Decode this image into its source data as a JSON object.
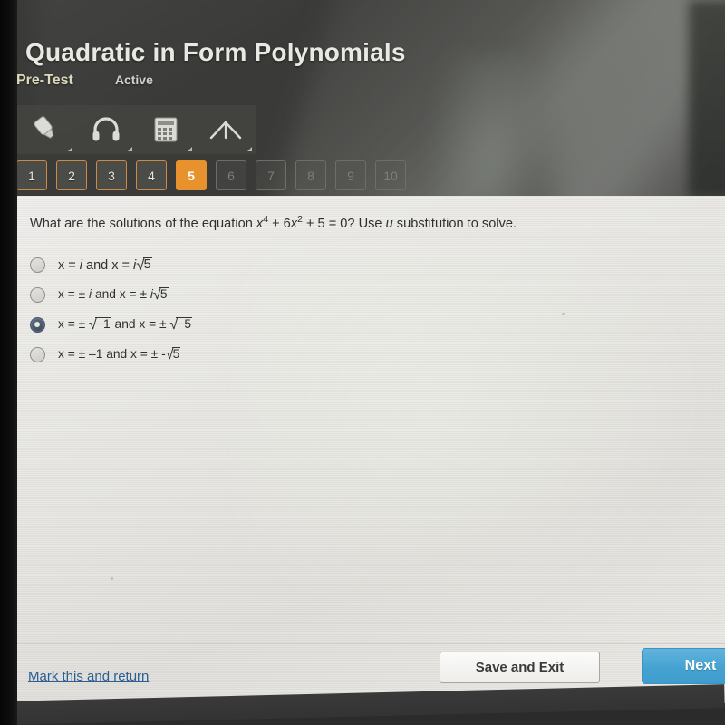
{
  "header": {
    "title": "Quadratic in Form Polynomials",
    "assignment_type": "Pre-Test",
    "status": "Active"
  },
  "toolbar": {
    "items": [
      {
        "name": "highlighter-icon",
        "label": "Highlighter"
      },
      {
        "name": "headphones-icon",
        "label": "Read Aloud"
      },
      {
        "name": "calculator-icon",
        "label": "Calculator"
      },
      {
        "name": "protractor-icon",
        "label": "Protractor"
      }
    ]
  },
  "question_nav": {
    "buttons": [
      {
        "label": "1",
        "state": "available"
      },
      {
        "label": "2",
        "state": "available"
      },
      {
        "label": "3",
        "state": "available"
      },
      {
        "label": "4",
        "state": "available"
      },
      {
        "label": "5",
        "state": "current"
      },
      {
        "label": "6",
        "state": "locked"
      },
      {
        "label": "7",
        "state": "locked"
      },
      {
        "label": "8",
        "state": "locked"
      },
      {
        "label": "9",
        "state": "locked"
      },
      {
        "label": "10",
        "state": "locked"
      }
    ],
    "current": "5",
    "accent_color": "#e8922e"
  },
  "question": {
    "prefix": "What are the solutions of the equation ",
    "term1_base": "x",
    "term1_exp": "4",
    "mid1": " + 6",
    "term2_base": "x",
    "term2_exp": "2",
    "mid2": " + 5 = 0? Use ",
    "variable": "u",
    "suffix": " substitution to solve.",
    "plain_text": "What are the solutions of the equation x^4 + 6x^2 + 5 = 0? Use u substitution to solve."
  },
  "options": [
    {
      "id": "a",
      "selected": false,
      "text": "x = i and x = i√5",
      "parts": {
        "lead": "x = ",
        "i1": "i",
        "and": " and x = ",
        "i2": "i",
        "radicand": "5",
        "neg_radical": false
      }
    },
    {
      "id": "b",
      "selected": false,
      "text": "x = ± i and x = ± i√5",
      "parts": {
        "lead": "x = ± ",
        "i1": "i",
        "and": " and x = ± ",
        "i2": "i",
        "radicand": "5",
        "neg_radical": false
      }
    },
    {
      "id": "c",
      "selected": true,
      "text": "x = ± √−1 and x = ± √−5",
      "parts": {
        "lead": "x = ± ",
        "rad1": "−1",
        "and": "  and x = ± ",
        "rad2": "−5"
      }
    },
    {
      "id": "d",
      "selected": false,
      "text": "x = ± –1 and x = ± -√5",
      "parts": {
        "lead": "x = ± –1",
        "and": " and x = ± -",
        "radicand": "5"
      }
    }
  ],
  "footer": {
    "mark_link": "Mark this and return",
    "save_exit": "Save and Exit",
    "next": "Next",
    "next_color": "#45a3d2",
    "link_color": "#2b5f92"
  }
}
